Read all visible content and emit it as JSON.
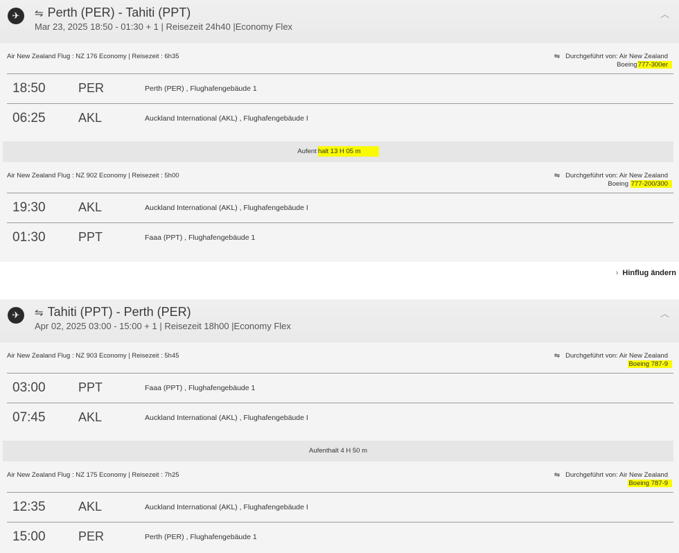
{
  "outbound": {
    "title": "Perth (PER) - Tahiti (PPT)",
    "subtitle": "Mar 23, 2025 18:50 - 01:30 + 1 | Reisezeit 24h40 |Economy Flex",
    "segments": [
      {
        "info": "Air New Zealand Flug : NZ 176 Economy | Reisezeit : 6h35",
        "operated_by": "Durchgeführt von: Air New Zealand",
        "aircraft_prefix": "Boeing",
        "aircraft_model": "777-300er",
        "stops": [
          {
            "time": "18:50",
            "code": "PER",
            "airport": "Perth (PER) , Flughafengebäude 1"
          },
          {
            "time": "06:25",
            "code": "AKL",
            "airport": "Auckland International (AKL) , Flughafengebäude I"
          }
        ]
      },
      {
        "info": "Air New Zealand Flug : NZ 902 Economy | Reisezeit : 5h00",
        "operated_by": "Durchgeführt von: Air New Zealand",
        "aircraft_prefix": "Boeing",
        "aircraft_model": "777-200/300",
        "stops": [
          {
            "time": "19:30",
            "code": "AKL",
            "airport": "Auckland International (AKL) , Flughafengebäude I"
          },
          {
            "time": "01:30",
            "code": "PPT",
            "airport": "Faaa (PPT) , Flughafengebäude 1"
          }
        ]
      }
    ],
    "layover_prefix": "Aufent",
    "layover_highlight": "halt 13 H 05 m"
  },
  "change_link": "Hinflug ändern",
  "return": {
    "title": "Tahiti (PPT) - Perth (PER)",
    "subtitle": "Apr 02, 2025 03:00 - 15:00 + 1 | Reisezeit 18h00 |Economy Flex",
    "segments": [
      {
        "info": "Air New Zealand Flug : NZ 903 Economy | Reisezeit : 5h45",
        "operated_by": "Durchgeführt von: Air New Zealand",
        "aircraft": "Boeing 787-9",
        "stops": [
          {
            "time": "03:00",
            "code": "PPT",
            "airport": "Faaa (PPT) , Flughafengebäude 1"
          },
          {
            "time": "07:45",
            "code": "AKL",
            "airport": "Auckland International (AKL) , Flughafengebäude I"
          }
        ]
      },
      {
        "info": "Air New Zealand Flug : NZ 175 Economy | Reisezeit : 7h25",
        "operated_by": "Durchgeführt von: Air New Zealand",
        "aircraft": "Boeing 787-9",
        "stops": [
          {
            "time": "12:35",
            "code": "AKL",
            "airport": "Auckland International (AKL) , Flughafengebäude I"
          },
          {
            "time": "15:00",
            "code": "PER",
            "airport": "Perth (PER) , Flughafengebäude 1"
          }
        ]
      }
    ],
    "layover": "Aufenthalt 4 H 50 m"
  },
  "colors": {
    "highlight": "#fafa00",
    "header_bg": "#ececec",
    "body_bg": "#f4f4f4"
  }
}
